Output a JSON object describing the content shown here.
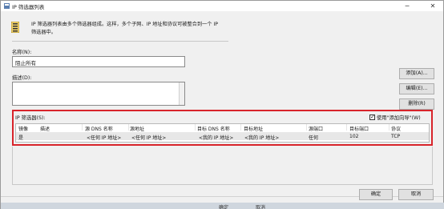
{
  "window": {
    "title": "IP 筛选器列表",
    "minimize_symbol": "─",
    "close_symbol": "✕"
  },
  "header": {
    "description": "IP 筛选器列表由多个筛选器组成。这样，多个子网、IP 地址和协议可被整合到一个 IP 筛选器中。",
    "icon": "filter-list-icon"
  },
  "form": {
    "name_label": "名称(N):",
    "name_value": "阻止所有",
    "description_label": "描述(D):",
    "description_value": ""
  },
  "side_buttons": {
    "add": "添加(A)...",
    "edit": "编辑(E)...",
    "remove": "删除(R)"
  },
  "filters": {
    "label": "IP 筛选器(S):",
    "use_wizard_label": "使用\"添加向导\"(W)",
    "use_wizard_checked": true,
    "columns": [
      "镜像",
      "描述",
      "源 DNS 名称",
      "源地址",
      "目标 DNS 名称",
      "目标地址",
      "源端口",
      "目标端口",
      "协议"
    ],
    "rows": [
      [
        "是",
        "",
        "<任何 IP 地址>",
        "<任何 IP 地址>",
        "<我的 IP 地址>",
        "<我的 IP 地址>",
        "任何",
        "102",
        "TCP"
      ]
    ]
  },
  "footer": {
    "ok": "确定",
    "cancel": "取消"
  },
  "background_window": {
    "ok": "确定",
    "cancel": "取消"
  },
  "colors": {
    "highlight_frame": "#d8242b",
    "selected_row": "#e7e7e7"
  }
}
